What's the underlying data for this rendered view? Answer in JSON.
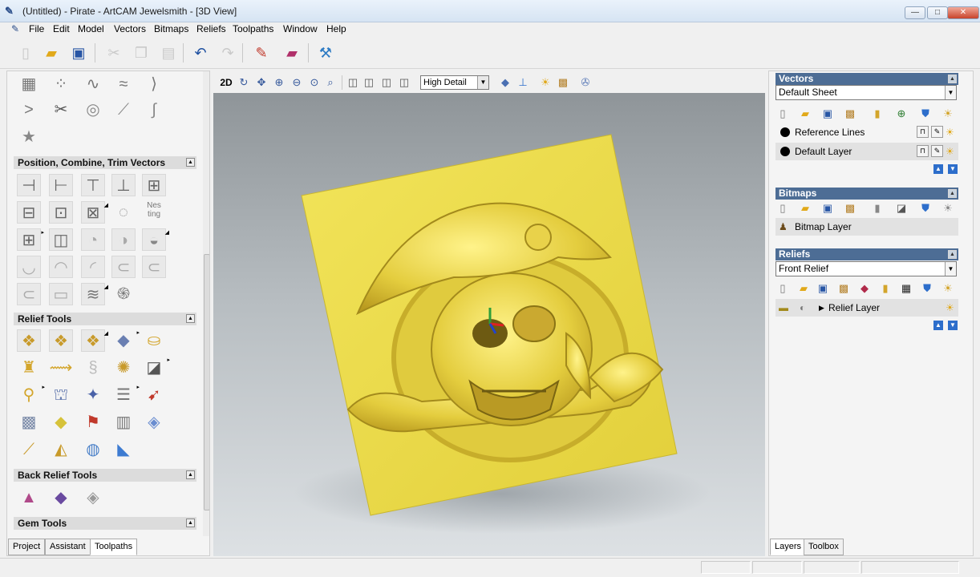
{
  "window": {
    "title": "(Untitled) - Pirate - ArtCAM Jewelsmith - [3D View]",
    "min": "—",
    "max": "□",
    "close": "✕",
    "mdi_min": "‒",
    "mdi_restore": "❐",
    "mdi_close": "✕"
  },
  "menu": [
    "File",
    "Edit",
    "Model",
    "Vectors",
    "Bitmaps",
    "Reliefs",
    "Toolpaths",
    "Window",
    "Help"
  ],
  "left": {
    "sections": [
      "Position, Combine, Trim Vectors",
      "Relief Tools",
      "Back Relief Tools",
      "Gem Tools"
    ],
    "nesting_label": "Nes ting",
    "tabs": [
      "Project",
      "Assistant",
      "Toolpaths"
    ]
  },
  "view": {
    "mode_2d": "2D",
    "detail": "High Detail"
  },
  "right": {
    "vectors": {
      "header": "Vectors",
      "sheet": "Default Sheet",
      "layers": [
        "Reference Lines",
        "Default Layer"
      ]
    },
    "bitmaps": {
      "header": "Bitmaps",
      "layer": "Bitmap Layer"
    },
    "reliefs": {
      "header": "Reliefs",
      "relief": "Front Relief",
      "layer": "Relief Layer"
    },
    "tabs": [
      "Layers",
      "Toolbox"
    ]
  },
  "colors": {
    "accent_header": "#4d6d95",
    "relief_gold": "#e6d84a",
    "viewport_bg": "#b7bdc1"
  }
}
